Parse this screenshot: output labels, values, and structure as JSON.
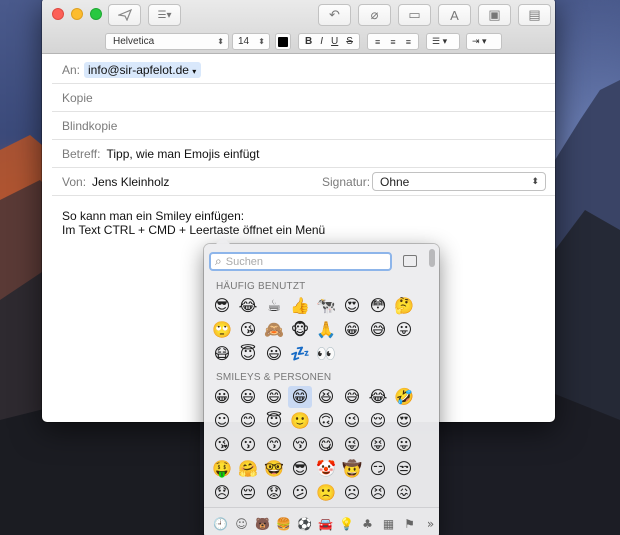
{
  "toolbar": {
    "send_icon": "paper-plane-icon",
    "list_icon": "list-icon",
    "reply_icon": "undo-arrow-icon",
    "attach_icon": "paperclip-icon",
    "markup_icon": "markup-icon",
    "font_button": "A",
    "photo_icon": "photo-browser-icon",
    "format_icon": "format-icon"
  },
  "format": {
    "font": "Helvetica",
    "size": "14",
    "bold": "B",
    "italic": "I",
    "underline": "U",
    "strike": "S"
  },
  "fields": {
    "to_label": "An:",
    "to_value": "info@sir-apfelot.de",
    "cc_label": "Kopie",
    "bcc_label": "Blindkopie",
    "subject_label": "Betreff:",
    "subject_value": "Tipp, wie man Emojis einfügt",
    "from_label": "Von:",
    "from_value": "Jens Kleinholz",
    "signature_label": "Signatur:",
    "signature_value": "Ohne"
  },
  "body": {
    "line1": "So kann man ein Smiley einfügen:",
    "line2": "Im Text CTRL + CMD + Leertaste öffnet ein Menü"
  },
  "picker": {
    "search_placeholder": "Suchen",
    "frequent_label": "HÄUFIG BENUTZT",
    "smileys_label": "SMILEYS & PERSONEN",
    "frequent": [
      "😎",
      "😂",
      "☕",
      "👍",
      "🐄",
      "😍",
      "😳",
      "🤔",
      "🙄",
      "😘",
      "🙈",
      "🐵",
      "🙏",
      "😁",
      "😅",
      "😛",
      "😷",
      "😇",
      "😃",
      "💤",
      "👀"
    ],
    "smileys": [
      "😀",
      "😃",
      "😄",
      "😁",
      "😆",
      "😅",
      "😂",
      "🤣",
      "☺",
      "😊",
      "😇",
      "🙂",
      "🙃",
      "😉",
      "😌",
      "😍",
      "😘",
      "😗",
      "😙",
      "😚",
      "😋",
      "😜",
      "😝",
      "😛",
      "🤑",
      "🤗",
      "🤓",
      "😎",
      "🤡",
      "🤠",
      "😏",
      "😒",
      "😞",
      "😔",
      "😟",
      "😕",
      "🙁",
      "☹",
      "😣",
      "😖"
    ],
    "selected_index": 3,
    "categories": [
      "🕘",
      "☺",
      "🐻",
      "🍔",
      "⚽",
      "🚘",
      "💡",
      "♣",
      "▦",
      "⚑",
      "»"
    ]
  }
}
